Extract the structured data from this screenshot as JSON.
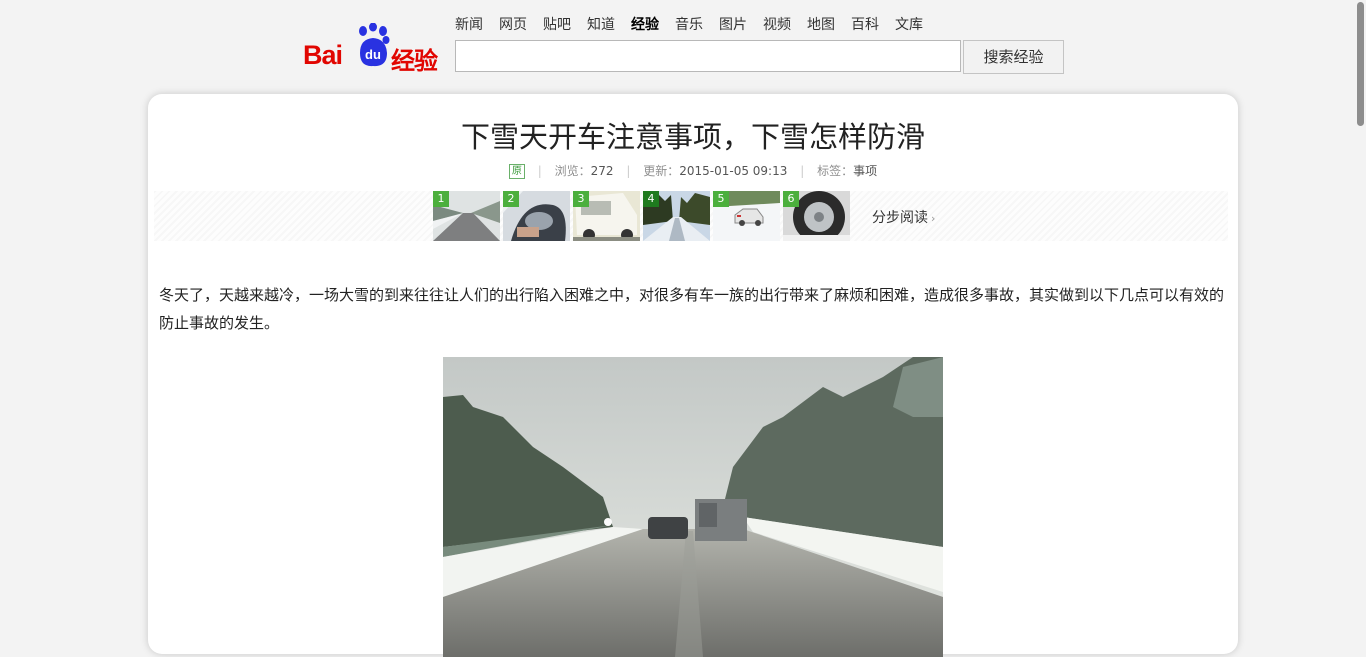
{
  "brand": {
    "logo_text": "Bai",
    "logo_du": "du",
    "logo_suffix": "经验"
  },
  "nav": [
    "新闻",
    "网页",
    "贴吧",
    "知道",
    "经验",
    "音乐",
    "图片",
    "视频",
    "地图",
    "百科",
    "文库"
  ],
  "nav_active": "经验",
  "search": {
    "value": "",
    "button_label": "搜索经验"
  },
  "article": {
    "title": "下雪天开车注意事项，下雪怎样防滑",
    "badge": "原",
    "views_label": "浏览：",
    "views": "272",
    "updated_label": "更新：",
    "updated": "2015-01-05 09:13",
    "tags_label": "标签：",
    "tags": "事项",
    "steps": [
      "1",
      "2",
      "3",
      "4",
      "5",
      "6"
    ],
    "step_read_label": "分步阅读",
    "intro": "冬天了，天越来越冷，一场大雪的到来往往让人们的出行陷入困难之中，对很多有车一族的出行带来了麻烦和困难，造成很多事故，其实做到以下几点可以有效的防止事故的发生。"
  },
  "colors": {
    "brand_red": "#e10601",
    "brand_blue": "#2932e1",
    "step_badge": "#4caf3d"
  }
}
